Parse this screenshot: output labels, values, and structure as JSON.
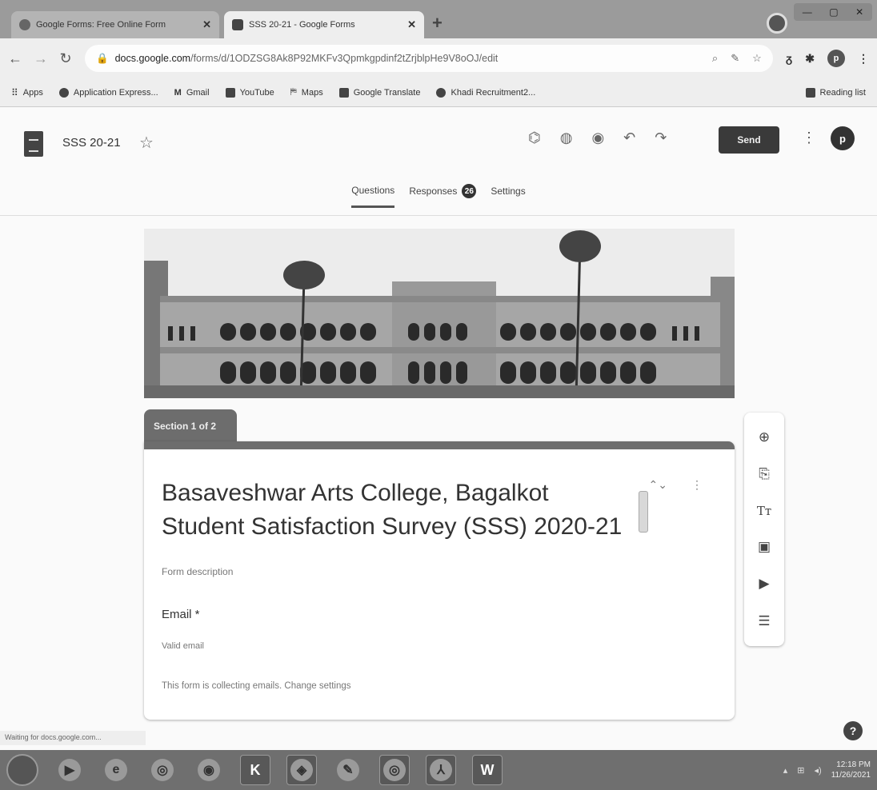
{
  "browser": {
    "tabs": [
      {
        "title": "Google Forms: Free Online Form",
        "icon": "google-icon",
        "active": false
      },
      {
        "title": "SSS 20-21 - Google Forms",
        "icon": "forms-icon",
        "active": true
      }
    ],
    "new_tab_label": "+",
    "url_host": "docs.google.com",
    "url_path": "/forms/d/1ODZSG8Ak8P92MKFv3Qpmkgpdinf2tZrjblpHe9V8oOJ/edit",
    "bookmarks": [
      {
        "label": "Apps",
        "icon": "apps-grid-icon"
      },
      {
        "label": "Application Express...",
        "icon": "globe-icon"
      },
      {
        "label": "Gmail",
        "icon": "gmail-icon"
      },
      {
        "label": "YouTube",
        "icon": "youtube-icon"
      },
      {
        "label": "Maps",
        "icon": "maps-icon"
      },
      {
        "label": "Google Translate",
        "icon": "translate-icon"
      },
      {
        "label": "Khadi Recruitment2...",
        "icon": "globe-icon"
      }
    ],
    "reading_list": "Reading list",
    "profile_initial": "p",
    "status_text": "Waiting for docs.google.com..."
  },
  "forms_header": {
    "doc_title": "SSS 20-21",
    "send_label": "Send",
    "avatar_initial": "p",
    "tabs": [
      {
        "label": "Questions",
        "active": true
      },
      {
        "label": "Responses",
        "badge": "26"
      },
      {
        "label": "Settings"
      }
    ]
  },
  "section": {
    "label": "Section 1 of 2",
    "title_line1": "Basaveshwar Arts College, Bagalkot",
    "title_line2": "Student Satisfaction Survey (SSS) 2020-21",
    "description_placeholder": "Form description",
    "email_label": "Email *",
    "email_hint": "Valid email",
    "collecting_text": "This form is collecting emails.",
    "change_settings": "Change settings"
  },
  "toolbar_icons": [
    "add-question-icon",
    "import-questions-icon",
    "add-title-icon",
    "add-image-icon",
    "add-video-icon",
    "add-section-icon"
  ],
  "taskbar": {
    "apps": [
      "start-icon",
      "media-player-icon",
      "internet-explorer-icon",
      "chrome-icon",
      "firefox-icon",
      "k-app-icon",
      "app-icon",
      "paint-icon",
      "chrome-active-icon",
      "acrobat-icon",
      "word-icon"
    ],
    "k_label": "K",
    "word_label": "W",
    "time": "12:18 PM",
    "date": "11/26/2021"
  },
  "help_label": "?"
}
